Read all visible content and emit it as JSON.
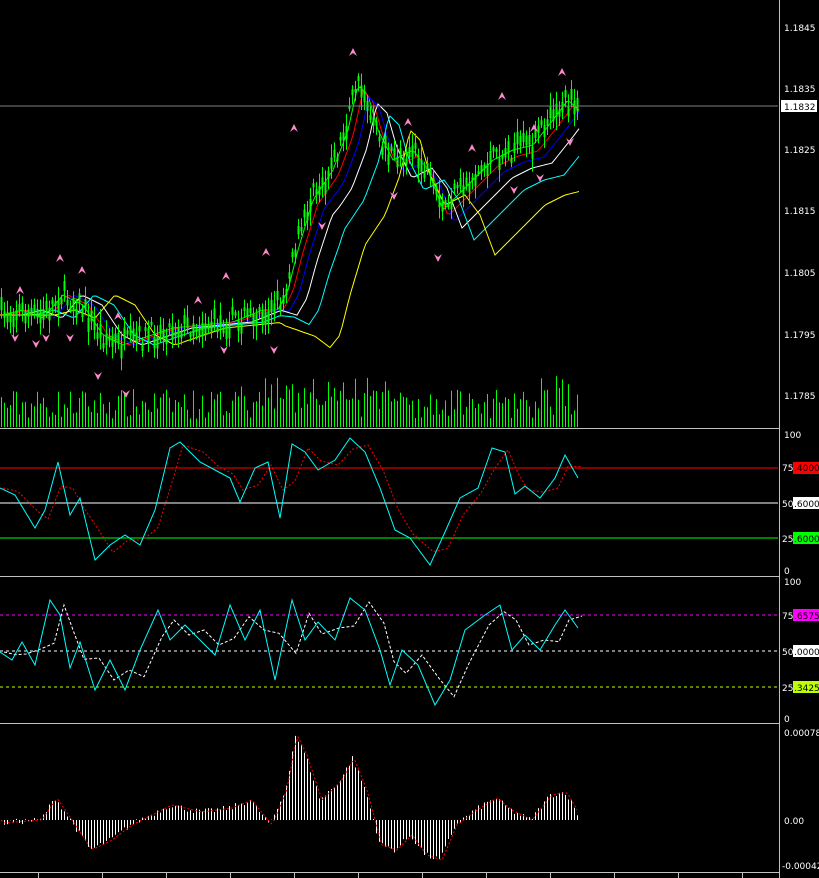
{
  "window": {
    "background": "#000000",
    "frame_color": "#c0c0c0"
  },
  "price_panel": {
    "price_ticks": [
      "1.1845",
      "1.1835",
      "1.1825",
      "1.1815",
      "1.1805",
      "1.1795",
      "1.1785"
    ],
    "current_price_label": "1.1832",
    "price_range": [
      1.178,
      1.185
    ],
    "candle_color": "#00ff00",
    "volume_color": "#00ff00",
    "fractal_color": "#ff88cc",
    "ma_colors": [
      "#00ff00",
      "#ff0000",
      "#0000ff",
      "#ffffff",
      "#00ffff",
      "#ffff00"
    ]
  },
  "oscillator_1": {
    "scale_ticks": [
      "100",
      "75",
      "50",
      "25",
      "0"
    ],
    "level_tags": [
      ".4000",
      ".6000",
      ".6000"
    ],
    "level_colors": [
      "#ff0000",
      "#ffffff",
      "#00ff00"
    ],
    "line_color": "#00ffff",
    "signal_color": "#ff0000"
  },
  "oscillator_2": {
    "scale_ticks": [
      "100",
      "75",
      "50",
      "25",
      "0"
    ],
    "level_tags": [
      ".6575",
      ".0000",
      ".3425"
    ],
    "level_colors": [
      "#ff00ff",
      "#ffffff",
      "#c0ff00"
    ],
    "line_color": "#00ffff",
    "signal_color": "#ffffff"
  },
  "histogram_panel": {
    "scale_ticks": [
      "0.00078",
      "0.00",
      "-0.00042"
    ],
    "range": [
      -0.00042,
      0.00078
    ],
    "bar_color": "#ffffff",
    "line_color": "#ff0000"
  }
}
